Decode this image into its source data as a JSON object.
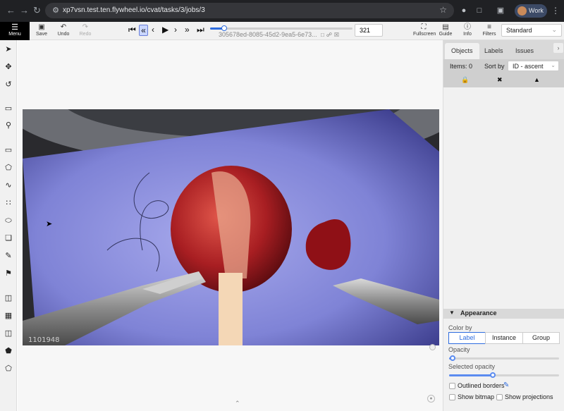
{
  "browser": {
    "url": "xp7vsn.test.ten.flywheel.io/cvat/tasks/3/jobs/3",
    "profile_name": "Work"
  },
  "toolbar": {
    "menu_label": "Menu",
    "save_label": "Save",
    "undo_label": "Undo",
    "redo_label": "Redo",
    "frame_filename": "305678ed-8085-45d2-9ea5-6e73...",
    "frame_number": "321",
    "frame_progress": 0.1,
    "fullscreen_label": "Fullscreen",
    "guide_label": "Guide",
    "info_label": "Info",
    "filters_label": "Filters",
    "workspace_value": "Standard"
  },
  "image": {
    "watermark": "1101948"
  },
  "right_panel": {
    "tabs": [
      "Objects",
      "Labels",
      "Issues"
    ],
    "active_tab": "Objects",
    "items_label": "Items: 0",
    "sort_label": "Sort by",
    "sort_value": "ID - ascent",
    "appearance": {
      "title": "Appearance",
      "color_by_label": "Color by",
      "color_by_options": [
        "Label",
        "Instance",
        "Group"
      ],
      "color_by_selected": "Label",
      "opacity_label": "Opacity",
      "opacity_value": 0.03,
      "selected_opacity_label": "Selected opacity",
      "selected_opacity_value": 0.4,
      "outlined_borders_label": "Outlined borders",
      "outlined_borders_checked": false,
      "show_bitmap_label": "Show bitmap",
      "show_bitmap_checked": false,
      "show_projections_label": "Show projections",
      "show_projections_checked": false
    }
  }
}
